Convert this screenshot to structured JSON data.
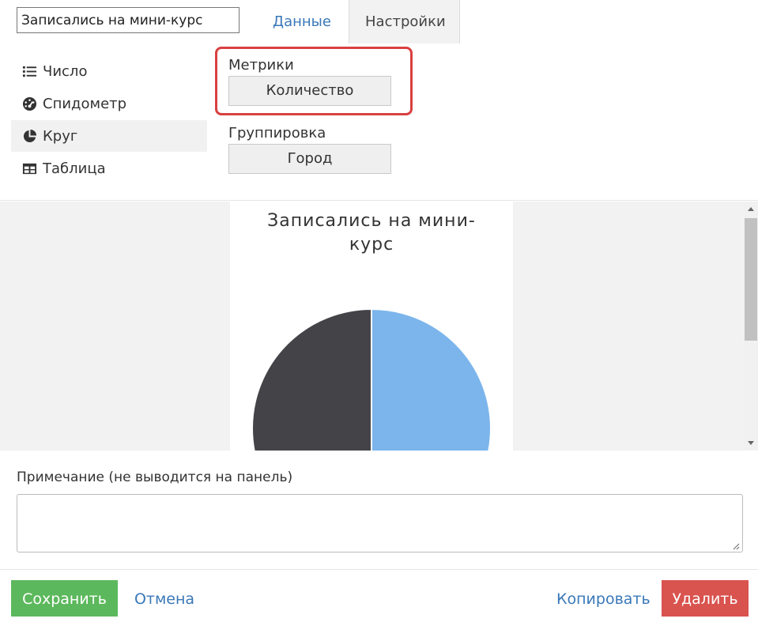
{
  "header": {
    "title_value": "Записались на мини-курс",
    "tabs": [
      {
        "label": "Данные"
      },
      {
        "label": "Настройки"
      }
    ]
  },
  "viz_types": [
    {
      "label": "Число",
      "icon": "list-icon"
    },
    {
      "label": "Спидометр",
      "icon": "speedometer-icon"
    },
    {
      "label": "Круг",
      "icon": "pie-chart-icon",
      "active": true
    },
    {
      "label": "Таблица",
      "icon": "table-icon"
    }
  ],
  "settings": {
    "metrics_label": "Метрики",
    "metrics_value": "Количество",
    "grouping_label": "Группировка",
    "grouping_value": "Город"
  },
  "chart_data": {
    "type": "pie",
    "title": "Записались на мини-курс",
    "values": [
      50,
      50
    ],
    "colors": [
      "#7cb5ec",
      "#434348"
    ]
  },
  "note": {
    "label": "Примечание (не выводится на панель)",
    "value": ""
  },
  "footer": {
    "save_label": "Сохранить",
    "cancel_label": "Отмена",
    "copy_label": "Копировать",
    "delete_label": "Удалить"
  },
  "colors": {
    "accent_link": "#3a78b8",
    "save": "#5cb85c",
    "delete": "#d9534f",
    "highlight": "#d94040"
  }
}
